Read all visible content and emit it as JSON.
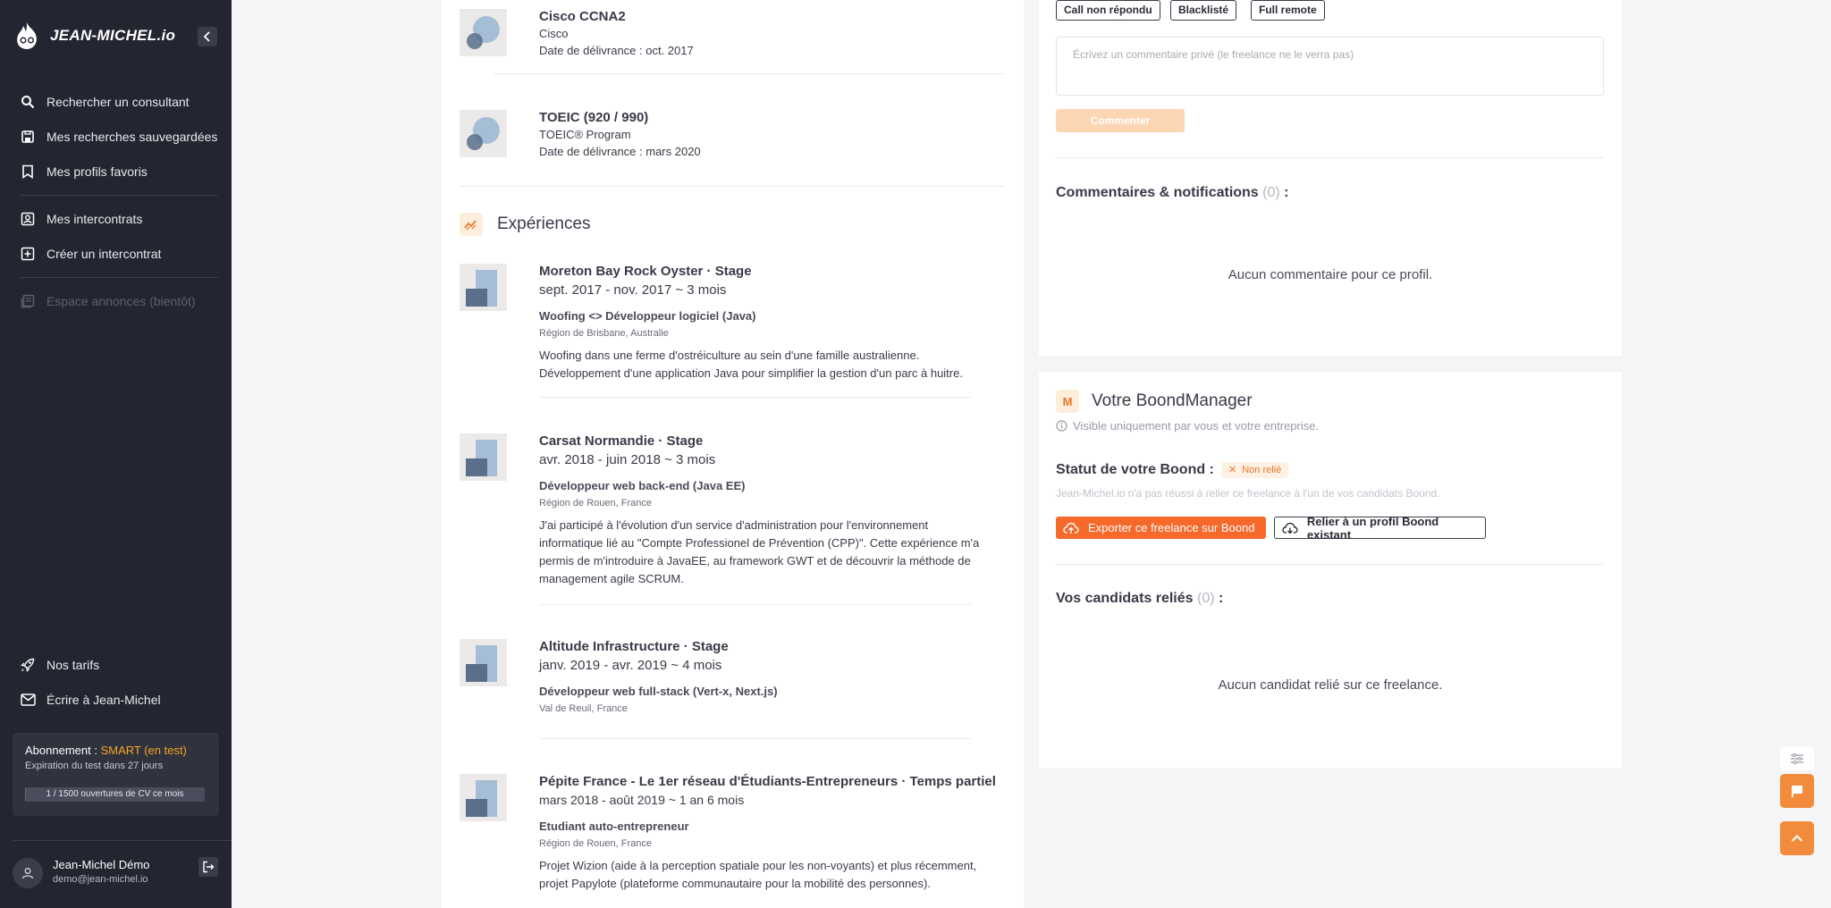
{
  "sidebar": {
    "brand": "JEAN-MICHEL.io",
    "nav": [
      {
        "label": "Rechercher un consultant",
        "icon": "search-icon"
      },
      {
        "label": "Mes recherches sauvegardées",
        "icon": "save-icon"
      },
      {
        "label": "Mes profils favoris",
        "icon": "bookmark-icon"
      },
      {
        "label": "Mes intercontrats",
        "icon": "contact-icon"
      },
      {
        "label": "Créer un intercontrat",
        "icon": "plus-square-icon"
      },
      {
        "label": "Espace annonces (bientôt)",
        "icon": "news-icon"
      }
    ],
    "bottom_nav": [
      {
        "label": "Nos tarifs",
        "icon": "rocket-icon"
      },
      {
        "label": "Écrire à Jean-Michel",
        "icon": "mail-icon"
      }
    ],
    "subscription": {
      "prefix": "Abonnement : ",
      "plan": "SMART (en test)",
      "expiry": "Expiration du test dans 27 jours",
      "quota": "1 / 1500 ouvertures de CV ce mois",
      "quota_fraction": 0.000667
    },
    "user": {
      "name": "Jean-Michel Démo",
      "email": "demo@jean-michel.io"
    }
  },
  "certifications": [
    {
      "title": "Cisco CCNA2",
      "org": "Cisco",
      "date": "Date de délivrance : oct. 2017"
    },
    {
      "title": "TOEIC (920 / 990)",
      "org": "TOEIC® Program",
      "date": "Date de délivrance : mars 2020"
    }
  ],
  "experiences_title": "Expériences",
  "experiences": [
    {
      "title": "Moreton Bay Rock Oyster · Stage",
      "dates": "sept. 2017 - nov. 2017 ~ 3 mois",
      "role": "Woofing <> Développeur logiciel (Java)",
      "location": "Région de Brisbane, Australie",
      "description": "Woofing dans une ferme d'ostréiculture au sein d'une famille australienne. Développement d'une application Java pour simplifier la gestion d'un parc à huitre."
    },
    {
      "title": "Carsat Normandie · Stage",
      "dates": "avr. 2018 - juin 2018 ~ 3 mois",
      "role": "Développeur web back-end (Java EE)",
      "location": "Région de Rouen, France",
      "description": "J'ai participé à l'évolution d'un service d'administration pour l'environnement informatique lié au \"Compte Professionel de Prévention (CPP)\". Cette expérience m'a permis de m'introduire à JavaEE, au framework GWT et de découvrir la méthode de management agile SCRUM."
    },
    {
      "title": "Altitude Infrastructure · Stage",
      "dates": "janv. 2019 - avr. 2019 ~ 4 mois",
      "role": "Développeur web full-stack (Vert-x, Next.js)",
      "location": "Val de Reuil, France",
      "description": ""
    },
    {
      "title": "Pépite France - Le 1er réseau d'Étudiants-Entrepreneurs · Temps partiel",
      "dates": "mars 2018 - août 2019 ~ 1 an 6 mois",
      "role": "Etudiant auto-entrepreneur",
      "location": "Région de Rouen, France",
      "description": "Projet Wizion (aide à la perception spatiale pour les non-voyants) et plus récemment, projet Papylote (plateforme communautaire pour la mobilité des personnes)."
    }
  ],
  "tags": [
    "Call non répondu",
    "Blacklisté",
    "Full remote"
  ],
  "comment": {
    "placeholder": "Écrivez un commentaire privé (le freelance ne le verra pas)",
    "button": "Commenter"
  },
  "comments_section": {
    "title": "Commentaires & notifications",
    "count": "(0)",
    "suffix": " :",
    "empty": "Aucun commentaire pour ce profil."
  },
  "boond": {
    "title": "Votre BoondManager",
    "visibility": "Visible uniquement par vous et votre entreprise.",
    "status_label": "Statut de votre Boond :",
    "status_badge": "Non relié",
    "status_note": "Jean-Michel.io n'a pas réussi à relier ce freelance à l'un de vos candidats Boond.",
    "export_button": "Exporter ce freelance sur Boond",
    "link_button": "Relier à un profil Boond existant",
    "candidates_title": "Vos candidats reliés",
    "candidates_count": "(0)",
    "candidates_suffix": " :",
    "candidates_empty": "Aucun candidat relié sur ce freelance."
  },
  "colors": {
    "accent": "#f5692b",
    "sidebar": "#232530",
    "smart": "#f6a623"
  }
}
